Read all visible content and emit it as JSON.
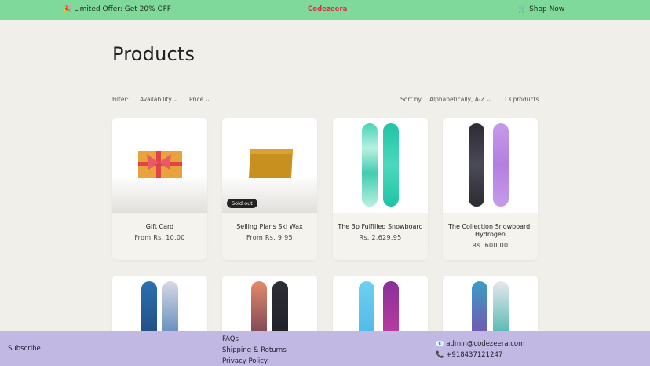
{
  "topbar": {
    "offer": "🎉 Limited Offer: Get 20% OFF",
    "brand": "Codezeera",
    "shop": "🛒 Shop Now"
  },
  "page": {
    "title": "Products"
  },
  "filters": {
    "label": "Filter:",
    "availability": "Availability",
    "price": "Price"
  },
  "sort": {
    "label": "Sort by:",
    "selected": "Alphabetically, A-Z",
    "count": "13 products"
  },
  "products": [
    {
      "name": "Gift Card",
      "price": "From Rs. 10.00"
    },
    {
      "name": "Selling Plans Ski Wax",
      "price": "From Rs. 9.95",
      "badge": "Sold out"
    },
    {
      "name": "The 3p Fulfilled Snowboard",
      "price": "Rs. 2,629.95"
    },
    {
      "name": "The Collection Snowboard: Hydrogen",
      "price": "Rs. 600.00"
    }
  ],
  "footer": {
    "subscribe": "Subscribe",
    "links": [
      "FAQs",
      "Shipping & Returns",
      "Privacy Policy"
    ],
    "email": "📧 admin@codezeera.com",
    "phone": "📞 +918437121247"
  },
  "colors": {
    "topbar": "#7ed99a",
    "brand": "#d93344",
    "footer": "#c1b8e4",
    "background": "#f1efe9"
  }
}
